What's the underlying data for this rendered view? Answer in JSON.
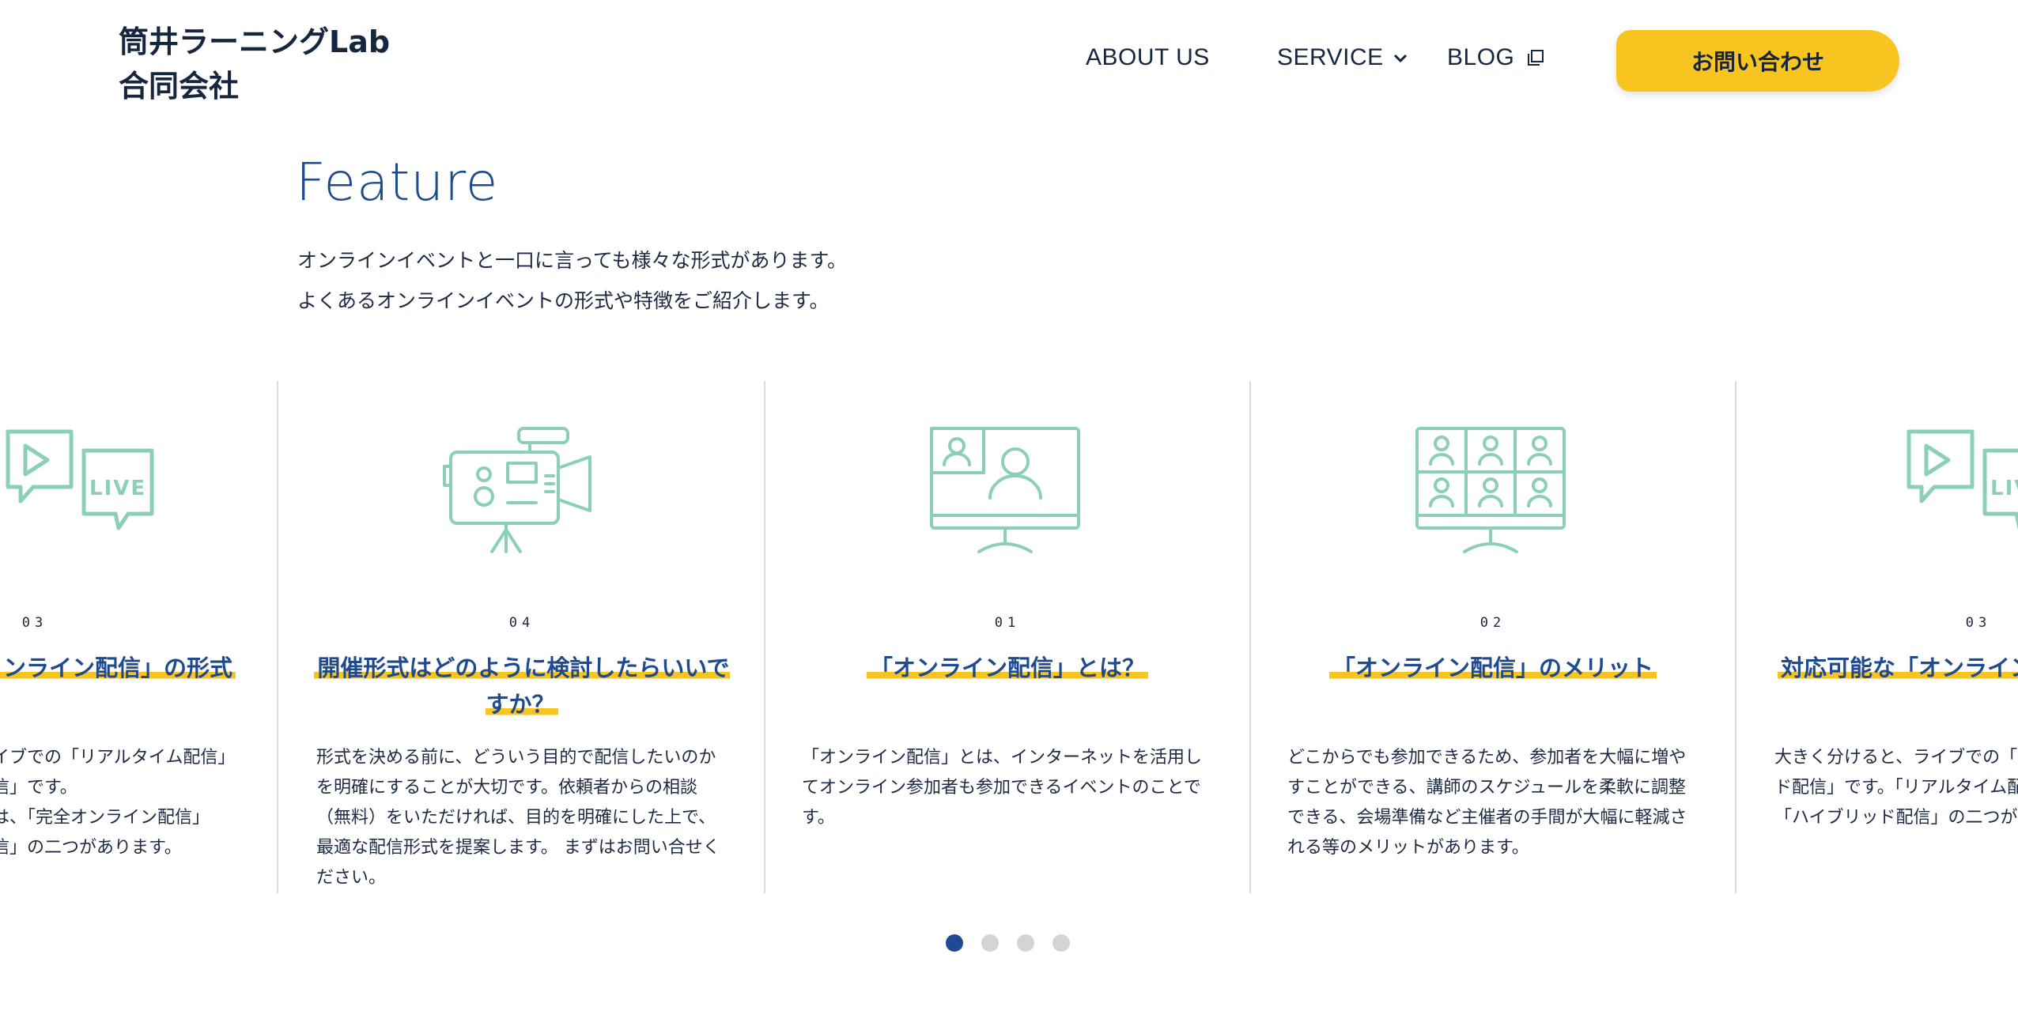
{
  "header": {
    "logo_line1": "筒井ラーニングLab",
    "logo_line2": "合同会社",
    "nav": {
      "about": "ABOUT US",
      "service": "SERVICE",
      "blog": "BLOG"
    },
    "cta_label": "お問い合わせ"
  },
  "feature": {
    "title": "Feature",
    "desc_line1": "オンラインイベントと一口に言っても様々な形式があります。",
    "desc_line2": "よくあるオンラインイベントの形式や特徴をご紹介します。"
  },
  "cards": [
    {
      "number": "03",
      "icon": "live-chat-icon",
      "title": "ンライン配信」の形式",
      "text": "イブでの「リアルタイム配信」信」です。は、「完全オンライン配信」信」の二つがあります。",
      "lines": [
        "イブでの「リアルタイム配信」",
        "信」です。",
        "は、「完全オンライン配信」",
        "信」の二つがあります。"
      ]
    },
    {
      "number": "04",
      "icon": "video-camera-icon",
      "title": "開催形式はどのように検討したらいいですか？",
      "text": "形式を決める前に、どういう目的で配信したいのかを明確にすることが大切です。依頼者からの相談（無料）をいただければ、目的を明確にした上で、最適な配信形式を提案します。 まずはお問い合せください。"
    },
    {
      "number": "01",
      "icon": "monitor-video-call-icon",
      "title": "「オンライン配信」とは？",
      "text": "「オンライン配信」とは、インターネットを活用してオンライン参加者も参加できるイベントのことです。"
    },
    {
      "number": "02",
      "icon": "monitor-group-call-icon",
      "title": "「オンライン配信」のメリット",
      "text": "どこからでも参加できるため、参加者を大幅に増やすことができる、講師のスケジュールを柔軟に調整できる、会場準備など主催者の手間が大幅に軽減される等のメリットがあります。"
    },
    {
      "number": "03",
      "icon": "live-chat-icon",
      "title": "対応可能な「オンライン配信」の形式",
      "text": "大きく分けると、ライブでの「リアルタイム配信」と、「オンデマンド配信」です。「リアルタイム配信」は、「完全オンライン配信」と「ハイブリッド配信」の二つがあります。"
    }
  ],
  "carousel": {
    "total": 4,
    "active": 1
  },
  "colors": {
    "accent": "#f8c41f",
    "brand": "#1f4a8f",
    "icon": "#8ccfb9",
    "text": "#16263f"
  }
}
